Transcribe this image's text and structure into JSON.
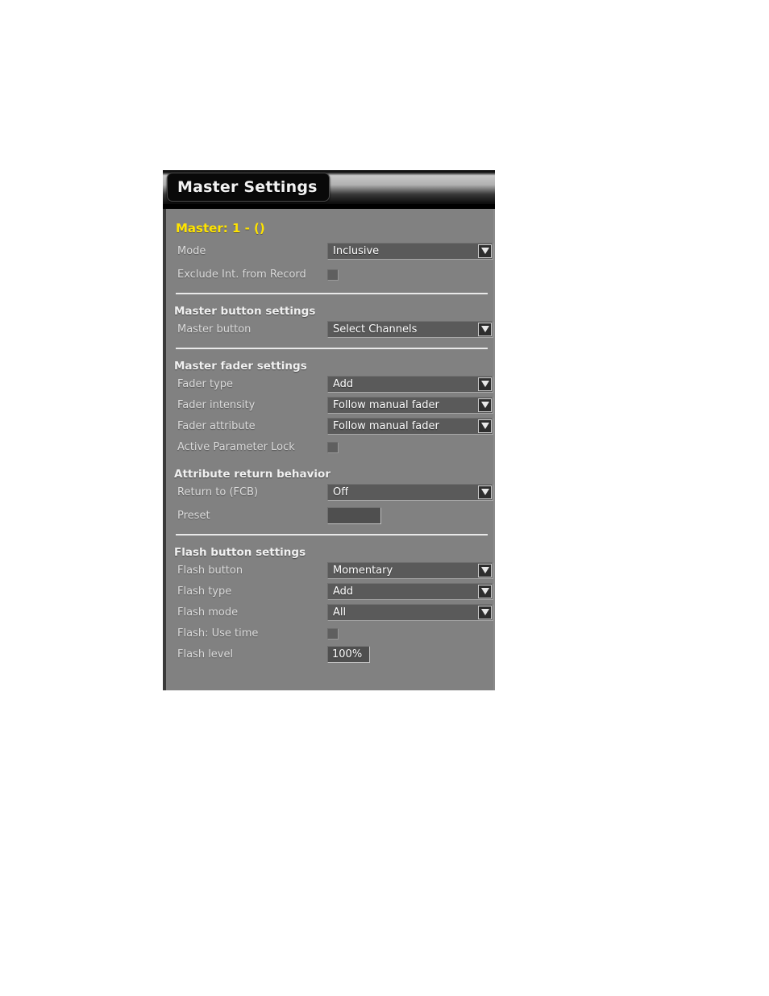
{
  "window": {
    "title": "Master Settings"
  },
  "master": {
    "heading": "Master: 1 - ()",
    "heading_color": "#ffe400"
  },
  "general": {
    "mode": {
      "label": "Mode",
      "value": "Inclusive"
    },
    "exclude_int_from_record": {
      "label": "Exclude Int. from Record",
      "checked": false
    }
  },
  "master_button_settings": {
    "title": "Master button settings",
    "master_button": {
      "label": "Master button",
      "value": "Select Channels"
    }
  },
  "master_fader_settings": {
    "title": "Master fader settings",
    "fader_type": {
      "label": "Fader type",
      "value": "Add"
    },
    "fader_intensity": {
      "label": "Fader intensity",
      "value": "Follow manual fader"
    },
    "fader_attribute": {
      "label": "Fader attribute",
      "value": "Follow manual fader"
    },
    "active_parameter_lock": {
      "label": "Active Parameter Lock",
      "checked": false
    }
  },
  "attribute_return_behavior": {
    "title": "Attribute return behavior",
    "return_to_fcb": {
      "label": "Return to (FCB)",
      "value": "Off"
    },
    "preset": {
      "label": "Preset",
      "value": ""
    }
  },
  "flash_button_settings": {
    "title": "Flash button settings",
    "flash_button": {
      "label": "Flash button",
      "value": "Momentary"
    },
    "flash_type": {
      "label": "Flash type",
      "value": "Add"
    },
    "flash_mode": {
      "label": "Flash mode",
      "value": "All"
    },
    "flash_use_time": {
      "label": "Flash: Use time",
      "checked": false
    },
    "flash_level": {
      "label": "Flash level",
      "value": "100%"
    }
  },
  "icons": {
    "dropdown_arrow": "chevron-down-icon"
  },
  "colors": {
    "panel_background": "#818181",
    "field_background": "#5a5a5a",
    "label_text": "#dcdcdc",
    "value_text": "#ffffff",
    "divider": "#e9e9e9",
    "accent_yellow": "#ffe400"
  }
}
